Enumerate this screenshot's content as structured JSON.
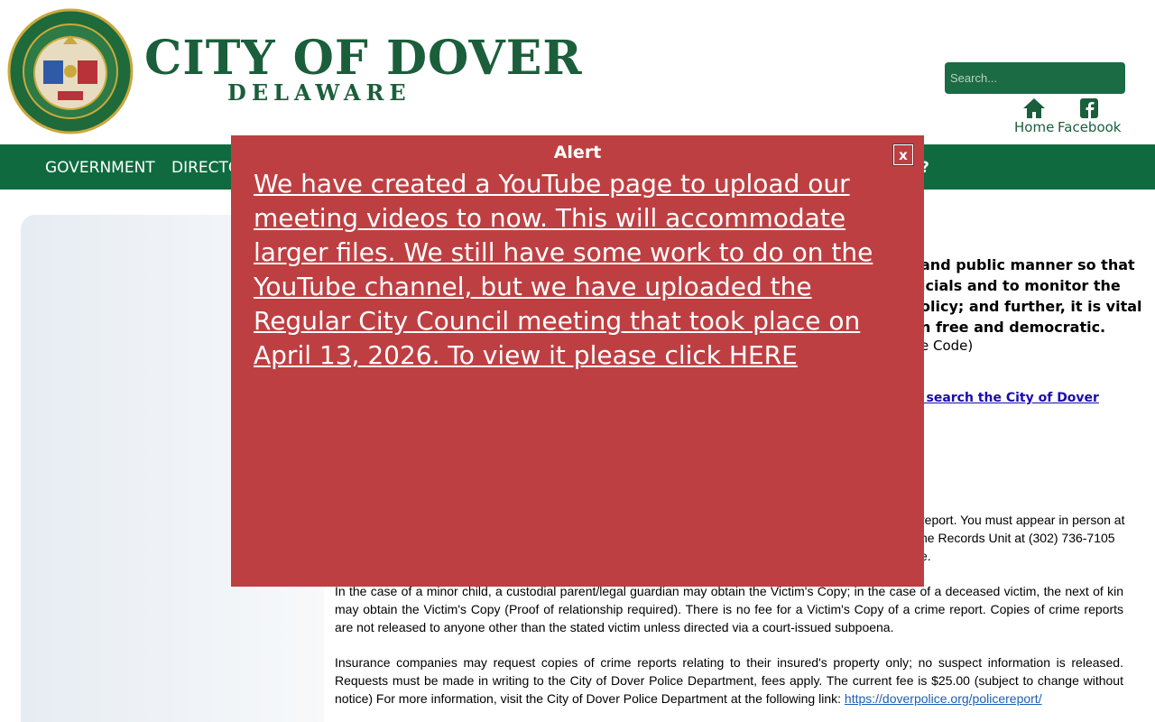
{
  "header": {
    "seal_alt": "City of Dover Delaware seal",
    "title": "CITY OF DOVER",
    "subtitle": "DELAWARE",
    "search_placeholder": "Search...",
    "home_label": "Home",
    "facebook_label": "Facebook"
  },
  "nav": {
    "items": [
      "GOVERNMENT",
      "DIRECTO"
    ],
    "trailing": "?"
  },
  "content": {
    "quote_lines": [
      "and public manner so that",
      "icials and to monitor the",
      "olicy; and further, it is vital",
      "n free and democratic."
    ],
    "code_ref": "e Code)",
    "search_link": "o search the City of Dover",
    "report_fragments": [
      "report. You must appear in person at",
      "he Records Unit at (302) 736-7105",
      "e."
    ],
    "para_minor": "In the case of a minor child, a custodial parent/legal guardian may obtain the Victim's Copy; in the case of a deceased victim, the next of kin may obtain the Victim's Copy (Proof of relationship required). There is no fee for a Victim's Copy of a crime report. Copies of crime reports are not released to anyone other than the stated victim unless directed via a court-issued subpoena.",
    "para_insurance": "Insurance companies may request copies of crime reports relating to their insured's property only; no suspect information is released. Requests must be made in writing to the City of Dover Police Department, fees apply. The current fee is $25.00 (subject to change without notice) For more information, visit the City of Dover Police Department at the following link:",
    "police_link": "https://doverpolice.org/policereport/"
  },
  "modal": {
    "title": "Alert",
    "close_label": "x",
    "message": "We have created a YouTube page to upload our meeting videos to now. This will accommodate larger files. We still have some work to do on the YouTube channel, but we have uploaded the Regular City Council meeting that took place on April 13, 2026. To view it please click HERE"
  },
  "colors": {
    "brand_green": "#1b5e3b",
    "nav_green": "#0f6b3f",
    "alert_red": "#be3f42"
  }
}
